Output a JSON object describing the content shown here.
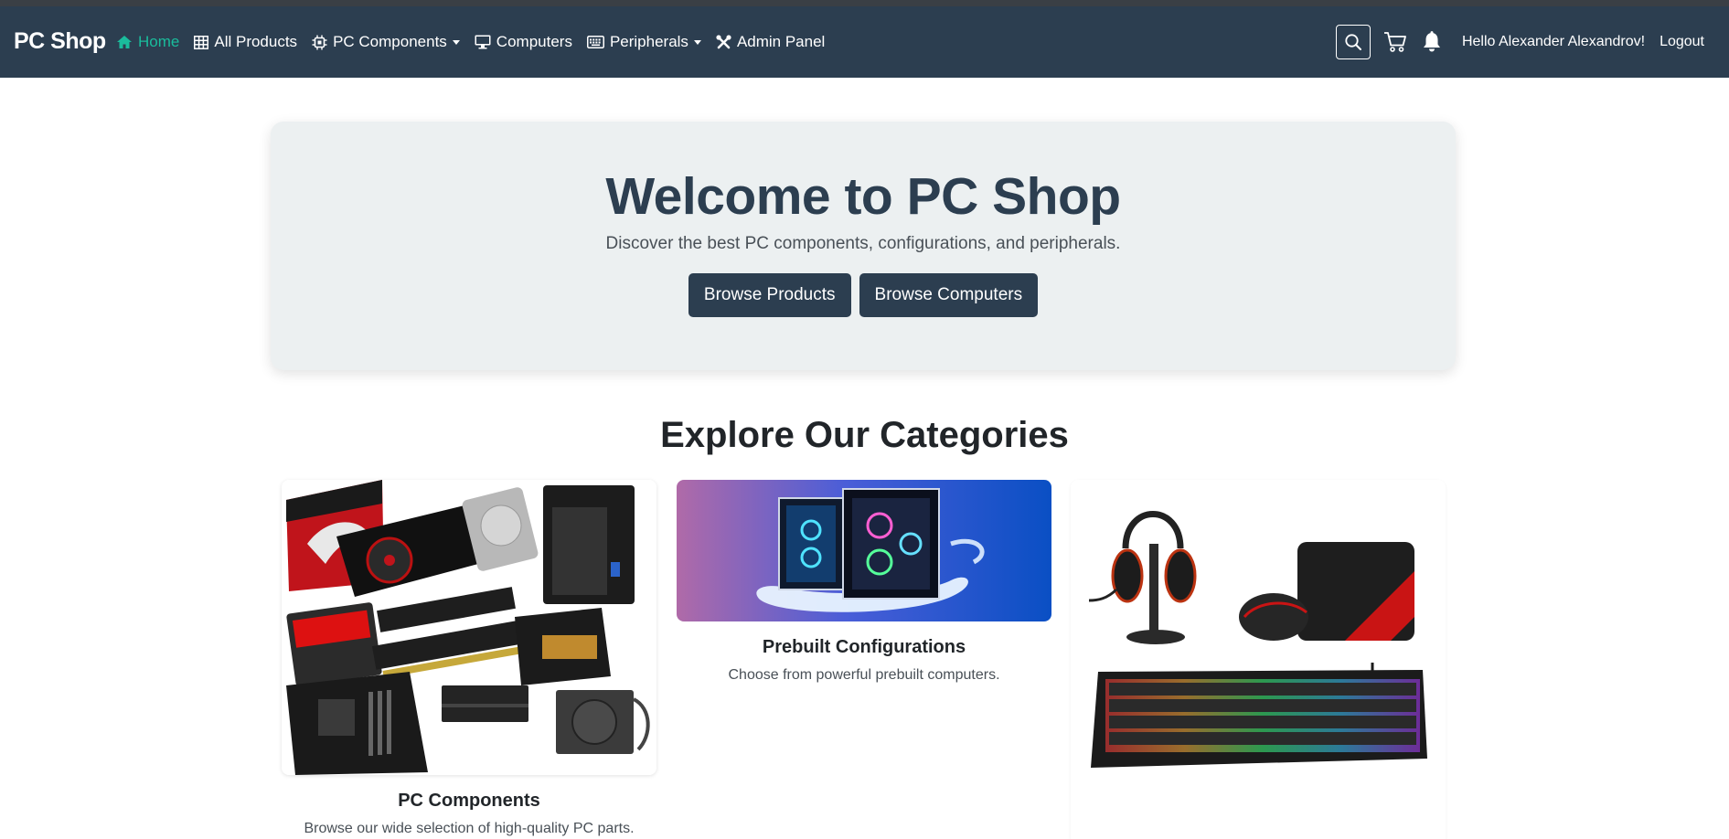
{
  "navbar": {
    "brand": "PC Shop",
    "links": [
      {
        "label": "Home",
        "icon": "home-icon"
      },
      {
        "label": "All Products",
        "icon": "grid-icon"
      },
      {
        "label": "PC Components",
        "icon": "cpu-icon"
      },
      {
        "label": "Computers",
        "icon": "monitor-icon"
      },
      {
        "label": "Peripherals",
        "icon": "keyboard-icon"
      },
      {
        "label": "Admin Panel",
        "icon": "tools-icon"
      }
    ],
    "greeting": "Hello Alexander Alexandrov!",
    "logout_label": "Logout",
    "accent_color": "#1abc9c",
    "bg_color": "#2c3e50"
  },
  "hero": {
    "title": "Welcome to PC Shop",
    "subtitle": "Discover the best PC components, configurations, and peripherals.",
    "browse_products_label": "Browse Products",
    "browse_computers_label": "Browse Computers"
  },
  "categories": {
    "title": "Explore Our Categories",
    "items": [
      {
        "title": "PC Components",
        "text": "Browse our wide selection of high-quality PC parts."
      },
      {
        "title": "Prebuilt Configurations",
        "text": "Choose from powerful prebuilt computers."
      },
      {
        "title": "",
        "text": ""
      }
    ]
  }
}
